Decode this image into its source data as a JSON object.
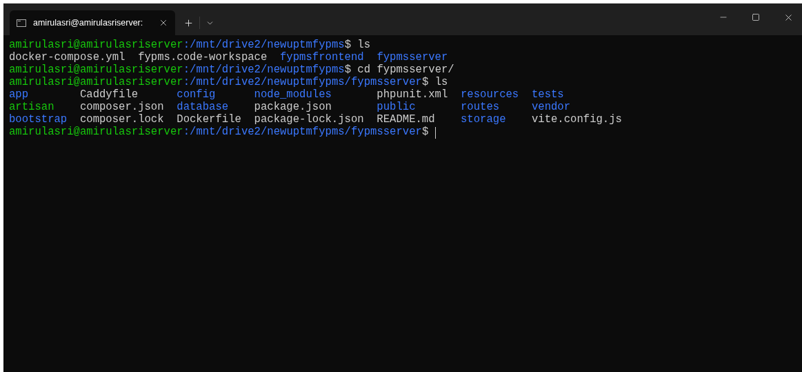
{
  "tab": {
    "title": "amirulasri@amirulasriserver:",
    "selected": true
  },
  "terminal": {
    "lines": [
      {
        "kind": "prompt",
        "user": "amirulasri@amirulasriserver",
        "path": ":/mnt/drive2/newuptmfypms",
        "command": "$ ls",
        "cursor": false
      },
      {
        "kind": "files",
        "entries": [
          {
            "text": "docker-compose.yml",
            "kind": "file"
          },
          {
            "text": "fypms.code-workspace",
            "kind": "file"
          },
          {
            "text": "fypmsfrontend",
            "kind": "dir"
          },
          {
            "text": "fypmsserver",
            "kind": "dir"
          }
        ]
      },
      {
        "kind": "prompt",
        "user": "amirulasri@amirulasriserver",
        "path": ":/mnt/drive2/newuptmfypms",
        "command": "$ cd fypmsserver/",
        "cursor": false
      },
      {
        "kind": "prompt",
        "user": "amirulasri@amirulasriserver",
        "path": ":/mnt/drive2/newuptmfypms/fypmsserver",
        "command": "$ ls",
        "cursor": false
      },
      {
        "kind": "file_grid",
        "entries": [
          {
            "text": "app",
            "kind": "dir"
          },
          {
            "text": "Caddyfile",
            "kind": "file"
          },
          {
            "text": "config",
            "kind": "dir"
          },
          {
            "text": "node_modules",
            "kind": "dir"
          },
          {
            "text": "phpunit.xml",
            "kind": "file"
          },
          {
            "text": "resources",
            "kind": "dir"
          },
          {
            "text": "tests",
            "kind": "dir"
          },
          {
            "text": "artisan",
            "kind": "exec"
          },
          {
            "text": "composer.json",
            "kind": "file"
          },
          {
            "text": "database",
            "kind": "dir"
          },
          {
            "text": "package.json",
            "kind": "file"
          },
          {
            "text": "public",
            "kind": "dir"
          },
          {
            "text": "routes",
            "kind": "dir"
          },
          {
            "text": "vendor",
            "kind": "dir"
          },
          {
            "text": "bootstrap",
            "kind": "dir"
          },
          {
            "text": "composer.lock",
            "kind": "file"
          },
          {
            "text": "Dockerfile",
            "kind": "file"
          },
          {
            "text": "package-lock.json",
            "kind": "file"
          },
          {
            "text": "README.md",
            "kind": "file"
          },
          {
            "text": "storage",
            "kind": "dir"
          },
          {
            "text": "vite.config.js",
            "kind": "file"
          }
        ]
      },
      {
        "kind": "prompt",
        "user": "amirulasri@amirulasriserver",
        "path": ":/mnt/drive2/newuptmfypms/fypmsserver",
        "command": "$",
        "cursor": true
      }
    ]
  }
}
